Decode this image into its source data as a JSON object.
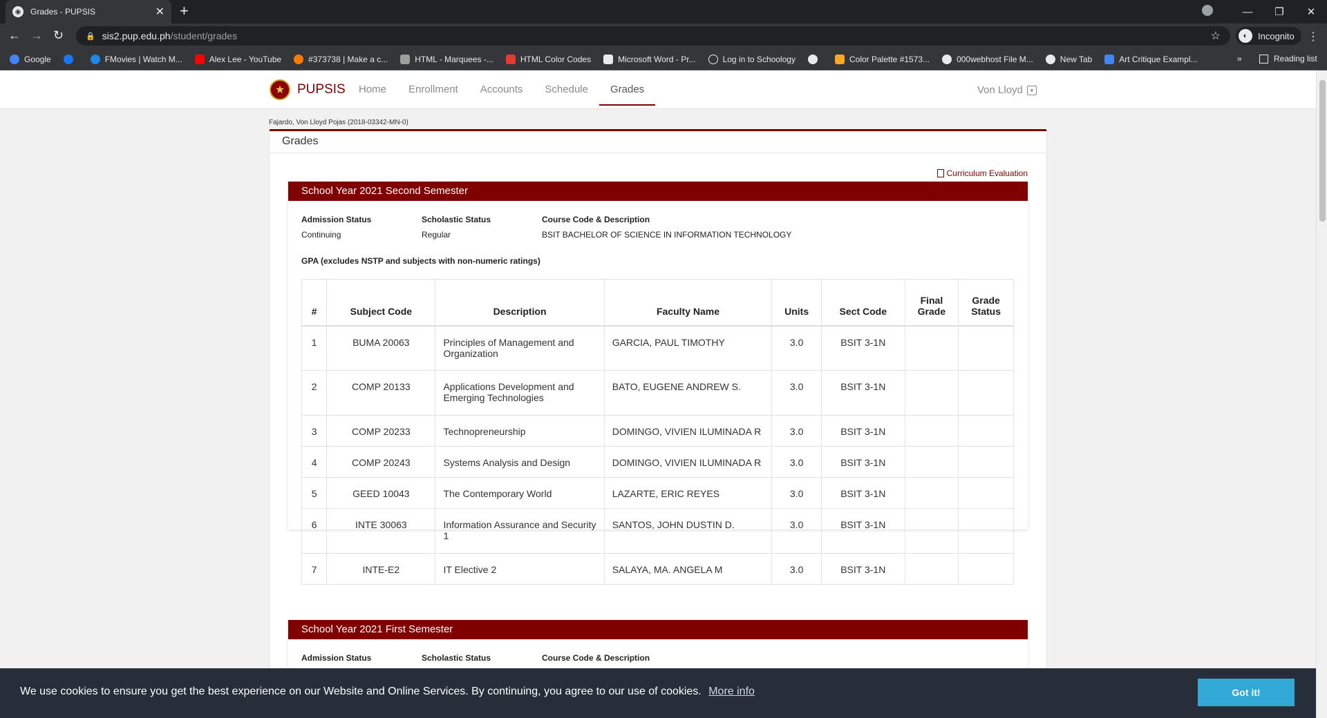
{
  "browser": {
    "tab_title": "Grades - PUPSIS",
    "url_host": "sis2.pup.edu.ph",
    "url_path": "/student/grades",
    "profile": "Incognito",
    "bookmarks": [
      {
        "label": "Google",
        "color": "#4285f4"
      },
      {
        "label": "",
        "color": "#1877f2"
      },
      {
        "label": "FMovies | Watch M...",
        "color": "#1e88e5"
      },
      {
        "label": "Alex Lee - YouTube",
        "color": "#ff0000"
      },
      {
        "label": "#373738 | Make a c...",
        "color": "#ff7a00"
      },
      {
        "label": "HTML - Marquees -...",
        "color": "#9e9e9e"
      },
      {
        "label": "HTML Color Codes",
        "color": "#e53935"
      },
      {
        "label": "Microsoft Word - Pr...",
        "color": "#e8eaed"
      },
      {
        "label": "Log in to Schoology",
        "color": "#e8eaed"
      },
      {
        "label": "",
        "color": "#e8eaed"
      },
      {
        "label": "Color Palette #1573...",
        "color": "#f9a825"
      },
      {
        "label": "000webhost File M...",
        "color": "#e8eaed"
      },
      {
        "label": "New Tab",
        "color": "#e8eaed"
      },
      {
        "label": "Art Critique Exampl...",
        "color": "#4285f4"
      }
    ],
    "more": "»",
    "reading_list": "Reading list"
  },
  "app": {
    "brand": "PUPSIS",
    "nav": [
      "Home",
      "Enrollment",
      "Accounts",
      "Schedule",
      "Grades"
    ],
    "active_nav": "Grades",
    "user": "Von Lloyd",
    "accent": "#800000"
  },
  "student": "Fajardo, Von Lloyd Pojas (2018-03342-MN-0)",
  "panel": {
    "title": "Grades",
    "curriculum_link": "Curriculum Evaluation"
  },
  "semesters": [
    {
      "title": "School Year 2021 Second Semester",
      "admission_label": "Admission Status",
      "admission_value": "Continuing",
      "scholastic_label": "Scholastic Status",
      "scholastic_value": "Regular",
      "course_label": "Course Code & Description",
      "course_value": "BSIT BACHELOR OF SCIENCE IN INFORMATION TECHNOLOGY",
      "gpa_label": "GPA (excludes NSTP and subjects with non-numeric ratings)",
      "columns": [
        "#",
        "Subject Code",
        "Description",
        "Faculty Name",
        "Units",
        "Sect Code",
        "Final Grade",
        "Grade Status"
      ],
      "rows": [
        {
          "num": "1",
          "code": "BUMA 20063",
          "desc": "Principles of Management and Organization",
          "faculty": "GARCIA, PAUL TIMOTHY",
          "units": "3.0",
          "sect": "BSIT 3-1N",
          "final": "",
          "status": ""
        },
        {
          "num": "2",
          "code": "COMP 20133",
          "desc": "Applications Development and Emerging Technologies",
          "faculty": "BATO, EUGENE ANDREW S.",
          "units": "3.0",
          "sect": "BSIT 3-1N",
          "final": "",
          "status": ""
        },
        {
          "num": "3",
          "code": "COMP 20233",
          "desc": "Technopreneurship",
          "faculty": "DOMINGO, VIVIEN ILUMINADA R",
          "units": "3.0",
          "sect": "BSIT 3-1N",
          "final": "",
          "status": ""
        },
        {
          "num": "4",
          "code": "COMP 20243",
          "desc": "Systems Analysis and Design",
          "faculty": "DOMINGO, VIVIEN ILUMINADA R",
          "units": "3.0",
          "sect": "BSIT 3-1N",
          "final": "",
          "status": ""
        },
        {
          "num": "5",
          "code": "GEED 10043",
          "desc": "The Contemporary World",
          "faculty": "LAZARTE, ERIC REYES",
          "units": "3.0",
          "sect": "BSIT 3-1N",
          "final": "",
          "status": ""
        },
        {
          "num": "6",
          "code": "INTE 30063",
          "desc": "Information Assurance and Security 1",
          "faculty": "SANTOS, JOHN DUSTIN D.",
          "units": "3.0",
          "sect": "BSIT 3-1N",
          "final": "",
          "status": ""
        },
        {
          "num": "7",
          "code": "INTE-E2",
          "desc": "IT Elective 2",
          "faculty": "SALAYA, MA. ANGELA M",
          "units": "3.0",
          "sect": "BSIT 3-1N",
          "final": "",
          "status": ""
        }
      ]
    },
    {
      "title": "School Year 2021 First Semester",
      "admission_label": "Admission Status",
      "scholastic_label": "Scholastic Status",
      "course_label": "Course Code & Description"
    }
  ],
  "cookie": {
    "message": "We use cookies to ensure you get the best experience on our Website and Online Services. By continuing, you agree to our use of cookies.",
    "more": "More info",
    "button": "Got it!"
  }
}
